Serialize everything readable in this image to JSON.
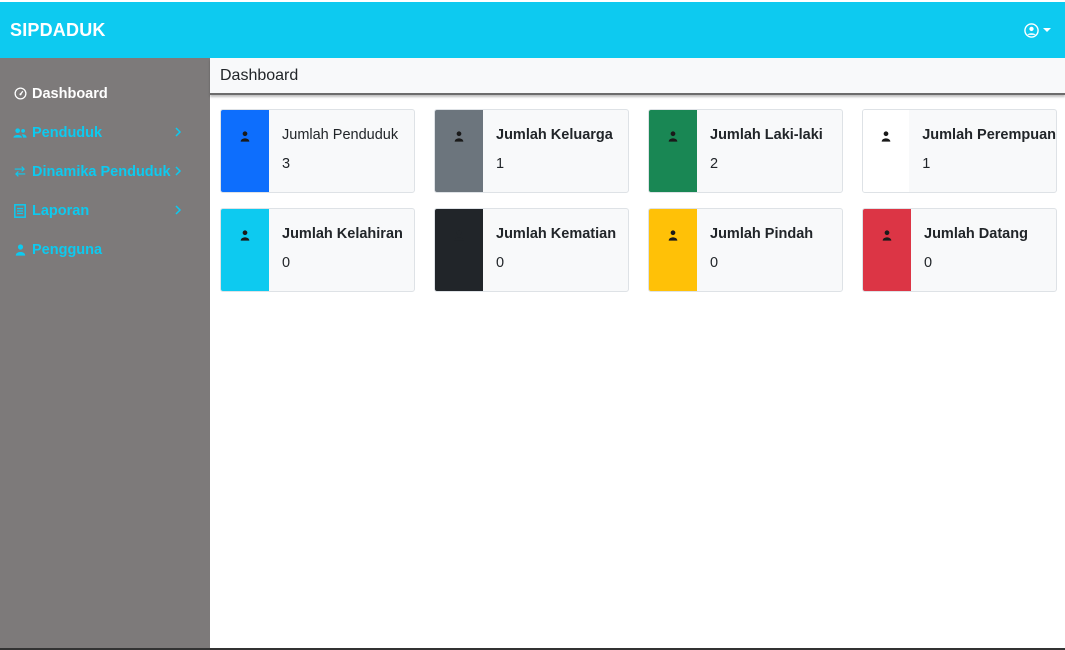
{
  "app": {
    "brand": "SIPDADUK",
    "accent_color": "#0dcaf0",
    "sidebar_color": "#7d7a7a",
    "user_icon": "user-circle-icon"
  },
  "sidebar": {
    "items": [
      {
        "label": "Dashboard",
        "icon": "gauge-icon",
        "active": true,
        "has_submenu": false
      },
      {
        "label": "Penduduk",
        "icon": "users-icon",
        "active": false,
        "has_submenu": true
      },
      {
        "label": "Dinamika Penduduk",
        "icon": "exchange-icon",
        "active": false,
        "has_submenu": true
      },
      {
        "label": "Laporan",
        "icon": "report-icon",
        "active": false,
        "has_submenu": true
      },
      {
        "label": "Pengguna",
        "icon": "user-icon",
        "active": false,
        "has_submenu": false
      }
    ]
  },
  "page": {
    "title": "Dashboard"
  },
  "cards": [
    {
      "title": "Jumlah Penduduk",
      "value": "3",
      "color": "#0d6efd",
      "icon": "user-icon"
    },
    {
      "title": "Jumlah Keluarga",
      "value": "1",
      "color": "#6c757d",
      "icon": "user-icon"
    },
    {
      "title": "Jumlah Laki-laki",
      "value": "2",
      "color": "#198754",
      "icon": "user-icon"
    },
    {
      "title": "Jumlah Perempuan",
      "value": "1",
      "color": "#ffffff",
      "icon": "user-icon"
    },
    {
      "title": "Jumlah Kelahiran",
      "value": "0",
      "color": "#0dcaf0",
      "icon": "user-icon"
    },
    {
      "title": "Jumlah Kematian",
      "value": "0",
      "color": "#212529",
      "icon": "user-icon"
    },
    {
      "title": "Jumlah Pindah",
      "value": "0",
      "color": "#ffc107",
      "icon": "user-icon"
    },
    {
      "title": "Jumlah Datang",
      "value": "0",
      "color": "#dc3545",
      "icon": "user-icon"
    }
  ]
}
